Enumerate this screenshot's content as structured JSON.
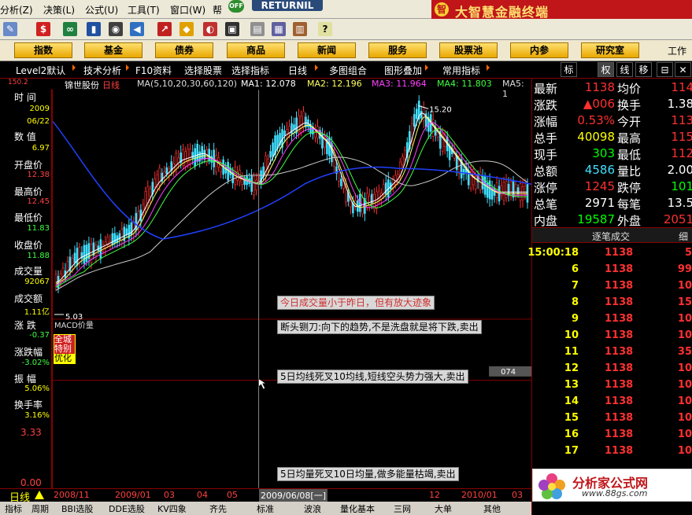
{
  "menu": {
    "items": [
      "分析(Z)",
      "决策(L)",
      "公式(U)",
      "工具(T)",
      "窗口(W)",
      "帮"
    ],
    "retur": "RETURNIL",
    "off": "OFF",
    "brand": "大智慧金融终端",
    "brand_logo": "智"
  },
  "toolbar_icons": [
    "pen-icon",
    "dollar-icon",
    "glasses-icon",
    "bar-chart-icon",
    "binoculars-icon",
    "speaker-icon",
    "arrow-icon",
    "diamond-icon",
    "car-icon",
    "hd-icon",
    "doc-icon",
    "note-icon",
    "window-icon",
    "books-icon",
    "help-pointer-icon"
  ],
  "nav": {
    "buttons": [
      "指数",
      "基金",
      "债券",
      "商品",
      "新闻",
      "服务",
      "股票池",
      "内参",
      "研究室"
    ],
    "end": "工作"
  },
  "tabs": [
    "Level2默认",
    "技术分析",
    "F10资料",
    "选择股票",
    "选择指标",
    "日线",
    "多图组合",
    "图形叠加",
    "常用指标"
  ],
  "rtabs": [
    "标",
    "权",
    "线",
    "移"
  ],
  "info": {
    "stock": "锦世股份",
    "period": "日线",
    "ma": "MA(5,10,20,30,60,120)",
    "ma1": "MA1: 12.078",
    "ma2": "MA2: 12.196",
    "ma3": "MA3: 11.964",
    "ma4": "MA4: 11.803",
    "ma5": "MA5: 1"
  },
  "left": {
    "time_lbl": "时  间",
    "time_v1": "2009",
    "time_v2": "06/22",
    "num_lbl": "数  值",
    "num_v": "6.97",
    "open_lbl": "开盘价",
    "open_v": "12.38",
    "high_lbl": "最高价",
    "high_v": "12.45",
    "low_lbl": "最低价",
    "low_v": "11.83",
    "close_lbl": "收盘价",
    "close_v": "11.88",
    "vol_lbl": "成交量",
    "vol_v": "92067",
    "amt_lbl": "成交额",
    "amt_v": "1.11亿",
    "chg_lbl": "涨  跌",
    "chg_v": "-0.37",
    "pct_lbl": "涨跌幅",
    "pct_v": "-3.02%",
    "amp_lbl": "振  幅",
    "amp_v": "5.06%",
    "turn_lbl": "换手率",
    "turn_v": "3.16%",
    "badge1": "全城",
    "badge2": "特别",
    "badge3": "优化",
    "axis_top": "150.2",
    "axis_mid": "3.33",
    "axis_low": "0.00",
    "period": "日线"
  },
  "chart": {
    "low_label": "5.03",
    "high_label": "15.20",
    "macd": "MACD价量",
    "marker": "074"
  },
  "tips": [
    "今日成交量小于昨日，但有放大迹象",
    "断头铡刀:向下的趋势,不是洗盘就是将下跌,卖出",
    "5日均线死叉10均线,短线空头势力强大,卖出",
    "5日均量死叉10日均量,做多能量枯竭,卖出"
  ],
  "dates": [
    "2008/11",
    "2009/01",
    "03",
    "04",
    "05",
    "2009/06/08[一]",
    "12",
    "2010/01",
    "03"
  ],
  "bottom": [
    "指标",
    "周期",
    "BBI选股",
    "DDE选股",
    "KV四象",
    "齐先",
    "标准",
    "波浪",
    "量化基本",
    "三网",
    "大单",
    "其他"
  ],
  "quote": {
    "rows": [
      {
        "k1": "最新",
        "v1": "1138",
        "k2": "均价",
        "v2": "114"
      },
      {
        "k1": "涨跌",
        "v1": "▲006",
        "k2": "换手",
        "v2": "1.38"
      },
      {
        "k1": "涨幅",
        "v1": "0.53%",
        "k2": "今开",
        "v2": "113"
      },
      {
        "k1": "总手",
        "v1": "40098",
        "k2": "最高",
        "v2": "115"
      },
      {
        "k1": "现手",
        "v1": "303",
        "k2": "最低",
        "v2": "112"
      },
      {
        "k1": "总额",
        "v1": "4586",
        "k2": "量比",
        "v2": "2.00"
      },
      {
        "k1": "涨停",
        "v1": "1245",
        "k2": "跌停",
        "v2": "101"
      },
      {
        "k1": "总笔",
        "v1": "2971",
        "k2": "每笔",
        "v2": "13.5"
      },
      {
        "k1": "内盘",
        "v1": "19587",
        "k2": "外盘",
        "v2": "2051"
      }
    ],
    "colors": {
      "red": "#ff3030",
      "white": "#ffffff",
      "green": "#00ff00",
      "yellow": "#ffff00",
      "cyan": "#40e0ff"
    }
  },
  "ticks": {
    "header": "逐笔成交",
    "header2": "细",
    "rows": [
      {
        "t": "15:00:18",
        "p": "1138",
        "v": "5"
      },
      {
        "t": "6",
        "p": "1138",
        "v": "99"
      },
      {
        "t": "7",
        "p": "1138",
        "v": "10"
      },
      {
        "t": "8",
        "p": "1138",
        "v": "15"
      },
      {
        "t": "9",
        "p": "1138",
        "v": "10"
      },
      {
        "t": "10",
        "p": "1138",
        "v": "10"
      },
      {
        "t": "11",
        "p": "1138",
        "v": "35"
      },
      {
        "t": "12",
        "p": "1138",
        "v": "10"
      },
      {
        "t": "13",
        "p": "1138",
        "v": "10"
      },
      {
        "t": "14",
        "p": "1138",
        "v": "10"
      },
      {
        "t": "15",
        "p": "1138",
        "v": "10"
      },
      {
        "t": "16",
        "p": "1138",
        "v": "10"
      },
      {
        "t": "17",
        "p": "1138",
        "v": "10"
      }
    ]
  },
  "watermark": {
    "title": "分析家公式网",
    "url": "www.88gs.com"
  }
}
